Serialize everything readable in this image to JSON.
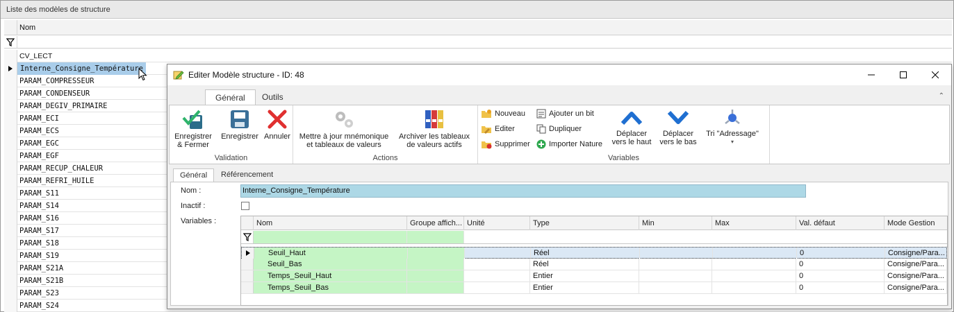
{
  "list_panel": {
    "title": "Liste des modèles de structure",
    "column_header": "Nom",
    "rows": [
      "CV_LECT",
      "Interne_Consigne_Température",
      "PARAM_COMPRESSEUR",
      "PARAM_CONDENSEUR",
      "PARAM_DEGIV_PRIMAIRE",
      "PARAM_ECI",
      "PARAM_ECS",
      "PARAM_EGC",
      "PARAM_EGF",
      "PARAM_RECUP_CHALEUR",
      "PARAM_REFRI_HUILE",
      "PARAM_S11",
      "PARAM_S14",
      "PARAM_S16",
      "PARAM_S17",
      "PARAM_S18",
      "PARAM_S19",
      "PARAM_S21A",
      "PARAM_S21B",
      "PARAM_S23",
      "PARAM_S24"
    ],
    "selected_index": 1
  },
  "dialog": {
    "title": "Editer Modèle structure - ID: 48",
    "ribbon_tabs": [
      "Général",
      "Outils"
    ],
    "active_ribbon_tab": "Général",
    "groups": {
      "validation": {
        "label": "Validation",
        "save_close": "Enregistrer & Fermer",
        "save": "Enregistrer",
        "cancel": "Annuler"
      },
      "actions": {
        "label": "Actions",
        "update_mnemonic": "Mettre à jour mnémonique et tableaux de valeurs",
        "archive_tables": "Archiver les tableaux de valeurs actifs"
      },
      "variables": {
        "label": "Variables",
        "new": "Nouveau",
        "edit": "Editer",
        "delete": "Supprimer",
        "add_bit": "Ajouter un bit",
        "duplicate": "Dupliquer",
        "import_nature": "Importer Nature",
        "move_up": "Déplacer vers le haut",
        "move_down": "Déplacer vers le bas",
        "sort": "Tri \"Adressage\""
      }
    },
    "inner_tabs": [
      "Général",
      "Référencement"
    ],
    "active_inner_tab": "Général",
    "form": {
      "name_label": "Nom :",
      "name_value": "Interne_Consigne_Température",
      "inactive_label": "Inactif :",
      "variables_label": "Variables :"
    },
    "variables_grid": {
      "columns": [
        "Nom",
        "Groupe affich...",
        "Unité",
        "Type",
        "Min",
        "Max",
        "Val. défaut",
        "Mode Gestion"
      ],
      "rows": [
        {
          "nom": "Seuil_Haut",
          "groupe": "",
          "unite": "",
          "type": "Réel",
          "min": "",
          "max": "",
          "defaut": "0",
          "mode": "Consigne/Para..."
        },
        {
          "nom": "Seuil_Bas",
          "groupe": "",
          "unite": "",
          "type": "Réel",
          "min": "",
          "max": "",
          "defaut": "0",
          "mode": "Consigne/Para..."
        },
        {
          "nom": "Temps_Seuil_Haut",
          "groupe": "",
          "unite": "",
          "type": "Entier",
          "min": "",
          "max": "",
          "defaut": "0",
          "mode": "Consigne/Para..."
        },
        {
          "nom": "Temps_Seuil_Bas",
          "groupe": "",
          "unite": "",
          "type": "Entier",
          "min": "",
          "max": "",
          "defaut": "0",
          "mode": "Consigne/Para..."
        }
      ],
      "selected_index": 0
    }
  },
  "colors": {
    "selection_blue": "#a9cdea",
    "name_field_blue": "#add8e6",
    "green_cells": "#c5f5c5",
    "save_teal": "#2d9c8f",
    "cancel_red": "#e03030",
    "arrow_blue": "#1f6fd1"
  },
  "icons": [
    "filter-icon",
    "row-pointer-icon",
    "save-close-icon",
    "save-icon",
    "cancel-icon",
    "gears-icon",
    "binders-icon",
    "folder-new-icon",
    "folder-edit-icon",
    "folder-delete-icon",
    "add-bit-icon",
    "duplicate-icon",
    "import-nature-icon",
    "arrow-up-icon",
    "arrow-down-icon",
    "sort-icon",
    "minimize-icon",
    "maximize-icon",
    "close-icon",
    "mouse-cursor-icon"
  ]
}
